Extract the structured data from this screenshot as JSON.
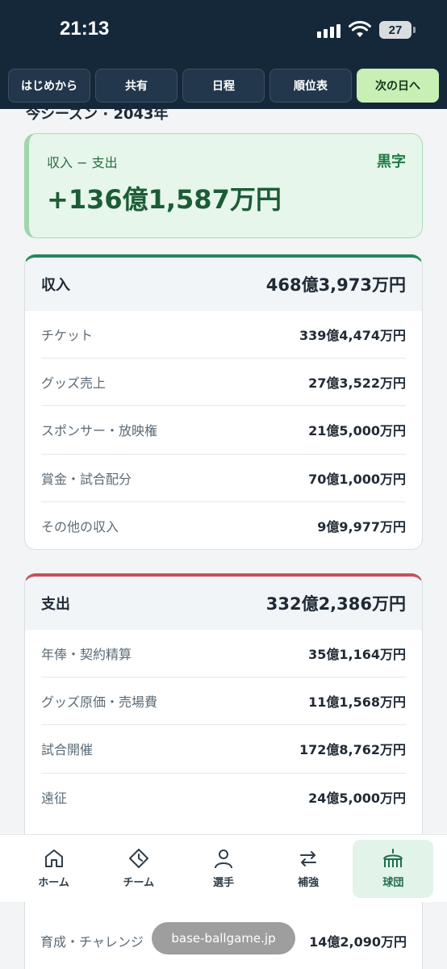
{
  "status_bar": {
    "time": "21:13",
    "battery": "27"
  },
  "nav_tabs": [
    {
      "label": "はじめから"
    },
    {
      "label": "共有"
    },
    {
      "label": "日程"
    },
    {
      "label": "順位表"
    },
    {
      "label": "次の日へ"
    }
  ],
  "season": {
    "title": "今シーズン · 2043年"
  },
  "balance": {
    "label": "収入 − 支出",
    "status": "黒字",
    "value": "+136億1,587万円",
    "accent_color": "#1e7a45"
  },
  "income": {
    "title": "収入",
    "total": "468億3,973万円",
    "accent_color": "#24885a",
    "rows": [
      {
        "label": "チケット",
        "value": "339億4,474万円"
      },
      {
        "label": "グッズ売上",
        "value": "27億3,522万円"
      },
      {
        "label": "スポンサー・放映権",
        "value": "21億5,000万円"
      },
      {
        "label": "賞金・試合配分",
        "value": "70億1,000万円"
      },
      {
        "label": "その他の収入",
        "value": "9億9,977万円"
      }
    ]
  },
  "expense": {
    "title": "支出",
    "total": "332億2,386万円",
    "accent_color": "#c4525e",
    "rows": [
      {
        "label": "年俸・契約精算",
        "value": "35億1,164万円"
      },
      {
        "label": "グッズ原価・売場費",
        "value": "11億1,568万円"
      },
      {
        "label": "試合開催",
        "value": "172億8,762万円"
      },
      {
        "label": "遠征",
        "value": "24億5,000万円"
      }
    ],
    "trailing_row": {
      "label": "育成・チャレンジ",
      "value": "14億2,090万円"
    }
  },
  "bottom_nav": [
    {
      "label": "ホーム",
      "icon": "home-icon"
    },
    {
      "label": "チーム",
      "icon": "diamond-clock-icon"
    },
    {
      "label": "選手",
      "icon": "person-icon"
    },
    {
      "label": "補強",
      "icon": "swap-icon"
    },
    {
      "label": "球団",
      "icon": "stadium-icon",
      "active": true
    }
  ],
  "browser": {
    "url": "base-ballgame.jp"
  }
}
